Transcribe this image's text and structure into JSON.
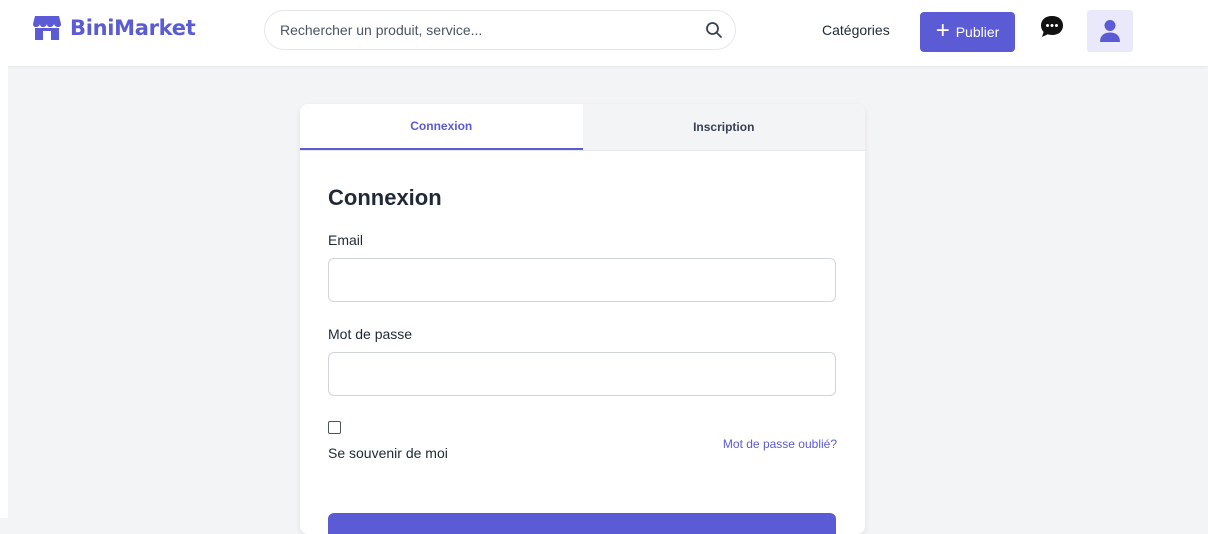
{
  "header": {
    "brand": "BiniMarket",
    "search_placeholder": "Rechercher un produit, service...",
    "categories_label": "Catégories",
    "publish_label": "Publier",
    "publish_plus": "+"
  },
  "card": {
    "tabs": [
      {
        "label": "Connexion",
        "active": true
      },
      {
        "label": "Inscription",
        "active": false
      }
    ],
    "form": {
      "title": "Connexion",
      "email_label": "Email",
      "email_value": "",
      "password_label": "Mot de passe",
      "password_value": "",
      "remember_label": "Se souvenir de moi",
      "remember_checked": false,
      "forgot_label": "Mot de passe oublié?"
    }
  },
  "icons": {
    "logo": "store-icon",
    "search": "search-icon",
    "chat": "chat-bubble-icon",
    "user": "user-icon"
  },
  "colors": {
    "accent": "#5b5bd6",
    "page_bg": "#f3f4f6",
    "user_button_bg": "#e9e9fb"
  }
}
